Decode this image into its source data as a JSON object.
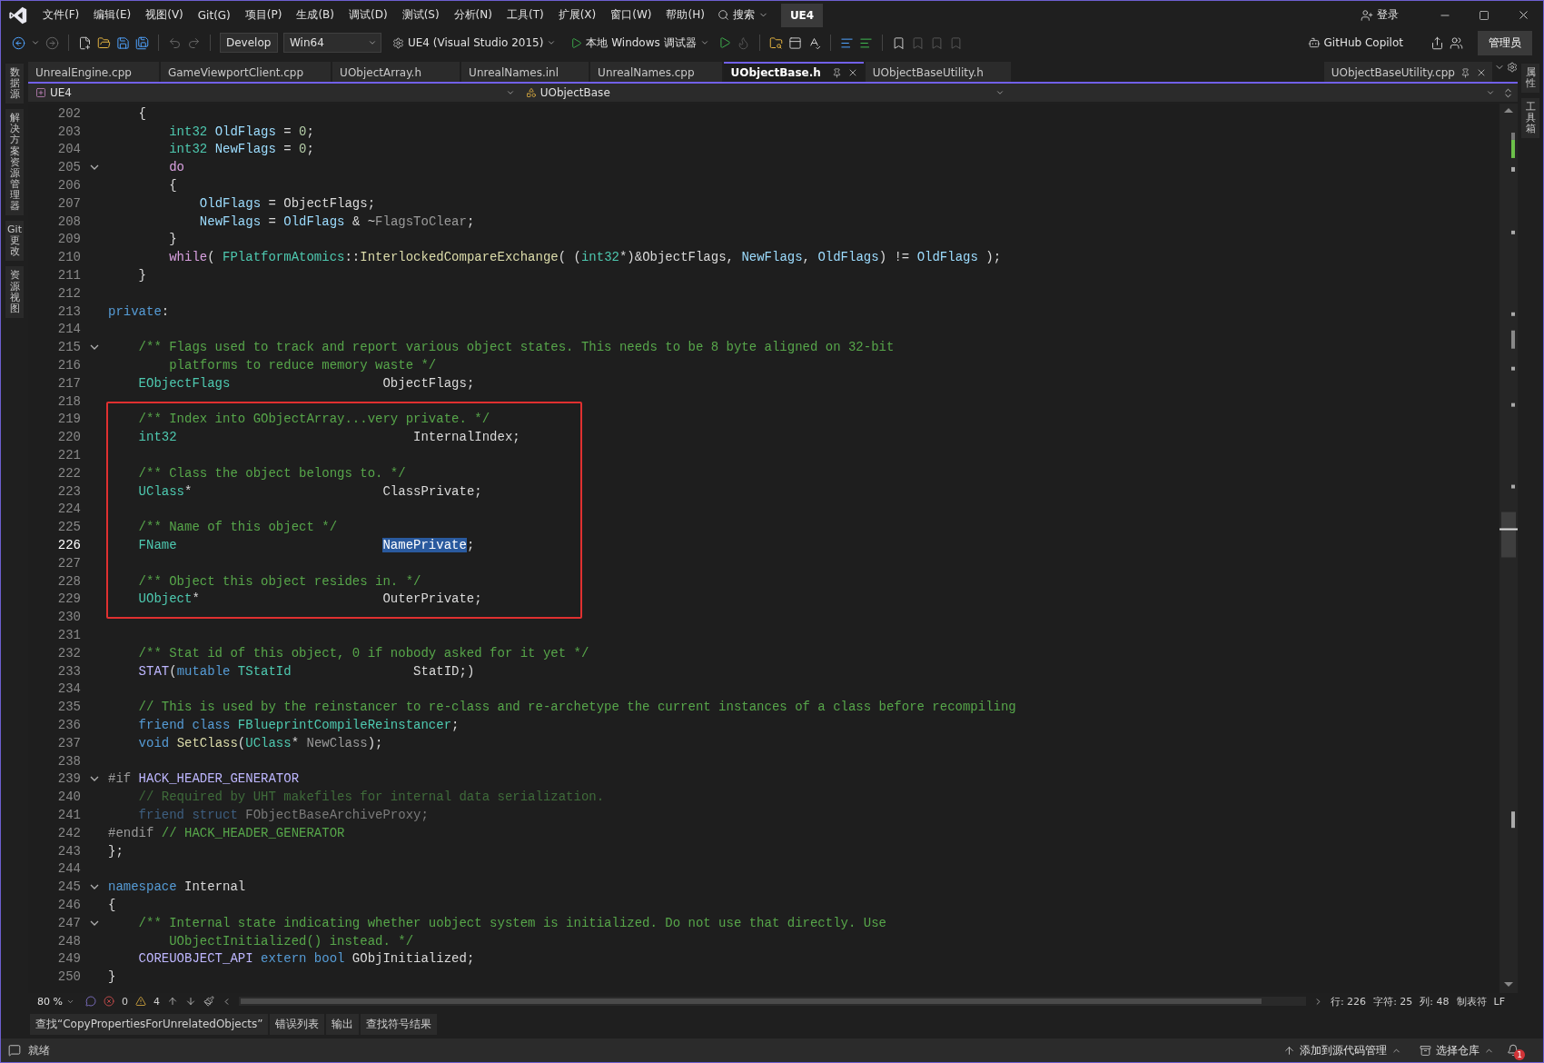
{
  "menu_bar": {
    "items": [
      "文件(F)",
      "编辑(E)",
      "视图(V)",
      "Git(G)",
      "项目(P)",
      "生成(B)",
      "调试(D)",
      "测试(S)",
      "分析(N)",
      "工具(T)",
      "扩展(X)",
      "窗口(W)",
      "帮助(H)"
    ],
    "search": "搜索",
    "solution": "UE4",
    "sign_in": "登录"
  },
  "toolbar": {
    "configuration": "Develop",
    "platform": "Win64",
    "startup_project": "UE4 (Visual Studio 2015)",
    "debugger": "本地 Windows 调试器",
    "copilot": "GitHub Copilot",
    "admin": "管理员"
  },
  "left_panels": [
    "数据源",
    "解决方案资源管理器",
    "Git 更改",
    "资源视图"
  ],
  "right_panels": [
    "属性",
    "工具箱"
  ],
  "tabs": [
    {
      "label": "UnrealEngine.cpp",
      "selected": false
    },
    {
      "label": "GameViewportClient.cpp",
      "selected": false
    },
    {
      "label": "UObjectArray.h",
      "selected": false
    },
    {
      "label": "UnrealNames.inl",
      "selected": false
    },
    {
      "label": "UnrealNames.cpp",
      "selected": false
    },
    {
      "label": "UObjectBase.h",
      "selected": true
    },
    {
      "label": "UObjectBaseUtility.h",
      "selected": false
    }
  ],
  "pinned_tab": {
    "label": "UObjectBaseUtility.cpp"
  },
  "navigation": {
    "project": "UE4",
    "scope": "UObjectBase"
  },
  "editor": {
    "sections": [
      {
        "framed": false,
        "lines": [
          {
            "number": "202",
            "fold": false,
            "current": false,
            "tokens": [
              {
                "kind": "plain",
                "text": "    {"
              }
            ]
          },
          {
            "number": "203",
            "fold": false,
            "current": false,
            "tokens": [
              {
                "kind": "type",
                "text": "        int32"
              },
              {
                "kind": "var",
                "text": " OldFlags"
              },
              {
                "kind": "plain",
                "text": " = "
              },
              {
                "kind": "num",
                "text": "0"
              },
              {
                "kind": "plain",
                "text": ";"
              }
            ]
          },
          {
            "number": "204",
            "fold": false,
            "current": false,
            "tokens": [
              {
                "kind": "type",
                "text": "        int32"
              },
              {
                "kind": "var",
                "text": " NewFlags"
              },
              {
                "kind": "plain",
                "text": " = "
              },
              {
                "kind": "num",
                "text": "0"
              },
              {
                "kind": "plain",
                "text": ";"
              }
            ]
          },
          {
            "number": "205",
            "fold": true,
            "current": false,
            "tokens": [
              {
                "kind": "ctrl",
                "text": "        do"
              }
            ]
          },
          {
            "number": "206",
            "fold": false,
            "current": false,
            "tokens": [
              {
                "kind": "plain",
                "text": "        {"
              }
            ]
          },
          {
            "number": "207",
            "fold": false,
            "current": false,
            "tokens": [
              {
                "kind": "var",
                "text": "            OldFlags"
              },
              {
                "kind": "plain",
                "text": " = ObjectFlags;"
              }
            ]
          },
          {
            "number": "208",
            "fold": false,
            "current": false,
            "tokens": [
              {
                "kind": "var",
                "text": "            NewFlags"
              },
              {
                "kind": "plain",
                "text": " = "
              },
              {
                "kind": "var",
                "text": "OldFlags"
              },
              {
                "kind": "plain",
                "text": " & ~"
              },
              {
                "kind": "param",
                "text": "FlagsToClear"
              },
              {
                "kind": "plain",
                "text": ";"
              }
            ]
          },
          {
            "number": "209",
            "fold": false,
            "current": false,
            "tokens": [
              {
                "kind": "plain",
                "text": "        }"
              }
            ]
          },
          {
            "number": "210",
            "fold": false,
            "current": false,
            "tokens": [
              {
                "kind": "ctrl",
                "text": "        while"
              },
              {
                "kind": "plain",
                "text": "( "
              },
              {
                "kind": "type",
                "text": "FPlatformAtomics"
              },
              {
                "kind": "plain",
                "text": "::"
              },
              {
                "kind": "func",
                "text": "InterlockedCompareExchange"
              },
              {
                "kind": "plain",
                "text": "( ("
              },
              {
                "kind": "type",
                "text": "int32"
              },
              {
                "kind": "plain",
                "text": "*)&ObjectFlags, "
              },
              {
                "kind": "var",
                "text": "NewFlags"
              },
              {
                "kind": "plain",
                "text": ", "
              },
              {
                "kind": "var",
                "text": "OldFlags"
              },
              {
                "kind": "plain",
                "text": ") != "
              },
              {
                "kind": "var",
                "text": "OldFlags"
              },
              {
                "kind": "plain",
                "text": " );"
              }
            ]
          },
          {
            "number": "211",
            "fold": false,
            "current": false,
            "tokens": [
              {
                "kind": "plain",
                "text": "    }"
              }
            ]
          },
          {
            "number": "212",
            "fold": false,
            "current": false
          },
          {
            "number": "213",
            "fold": false,
            "current": false,
            "tokens": [
              {
                "kind": "kw",
                "text": "private"
              },
              {
                "kind": "plain",
                "text": ":"
              }
            ]
          },
          {
            "number": "214",
            "fold": false,
            "current": false
          },
          {
            "number": "215",
            "fold": true,
            "current": false,
            "tokens": [
              {
                "kind": "comment",
                "text": "    /** Flags used to track and report various object states. This needs to be 8 byte aligned on 32-bit"
              }
            ]
          },
          {
            "number": "216",
            "fold": false,
            "current": false,
            "tokens": [
              {
                "kind": "comment",
                "text": "        platforms to reduce memory waste */"
              }
            ]
          },
          {
            "number": "217",
            "fold": false,
            "current": false,
            "tokens": [
              {
                "kind": "type",
                "text": "    EObjectFlags"
              },
              {
                "kind": "plain",
                "text": "                    ObjectFlags;"
              }
            ]
          },
          {
            "number": "218",
            "fold": false,
            "current": false
          }
        ]
      },
      {
        "framed": true,
        "lines": [
          {
            "number": "219",
            "fold": false,
            "current": false,
            "tokens": [
              {
                "kind": "comment",
                "text": "    /** Index into GObjectArray...very private. */"
              }
            ]
          },
          {
            "number": "220",
            "fold": false,
            "current": false,
            "tokens": [
              {
                "kind": "type",
                "text": "    int32"
              },
              {
                "kind": "plain",
                "text": "                               InternalIndex;"
              }
            ]
          },
          {
            "number": "221",
            "fold": false,
            "current": false
          },
          {
            "number": "222",
            "fold": false,
            "current": false,
            "tokens": [
              {
                "kind": "comment",
                "text": "    /** Class the object belongs to. */"
              }
            ]
          },
          {
            "number": "223",
            "fold": false,
            "current": false,
            "tokens": [
              {
                "kind": "type",
                "text": "    UClass"
              },
              {
                "kind": "plain",
                "text": "*                         ClassPrivate;"
              }
            ]
          },
          {
            "number": "224",
            "fold": false,
            "current": false
          },
          {
            "number": "225",
            "fold": false,
            "current": false,
            "tokens": [
              {
                "kind": "comment",
                "text": "    /** Name of this object */"
              }
            ]
          },
          {
            "number": "226",
            "fold": false,
            "current": true,
            "tokens": [
              {
                "kind": "type",
                "text": "    FName                           "
              },
              {
                "kind": "selected",
                "text": "NamePrivate"
              },
              {
                "kind": "plain",
                "text": ";"
              }
            ]
          },
          {
            "number": "227",
            "fold": false,
            "current": false
          },
          {
            "number": "228",
            "fold": false,
            "current": false,
            "tokens": [
              {
                "kind": "comment",
                "text": "    /** Object this object resides in. */"
              }
            ]
          },
          {
            "number": "229",
            "fold": false,
            "current": false,
            "tokens": [
              {
                "kind": "type",
                "text": "    UObject"
              },
              {
                "kind": "plain",
                "text": "*                        OuterPrivate;"
              }
            ]
          }
        ]
      },
      {
        "framed": false,
        "lines": [
          {
            "number": "230",
            "fold": false,
            "current": false
          },
          {
            "number": "231",
            "fold": false,
            "current": false
          },
          {
            "number": "232",
            "fold": false,
            "current": false,
            "tokens": [
              {
                "kind": "comment",
                "text": "    /** Stat id of this object, 0 if nobody asked for it yet */"
              }
            ]
          },
          {
            "number": "233",
            "fold": false,
            "current": false,
            "tokens": [
              {
                "kind": "macro",
                "text": "    STAT"
              },
              {
                "kind": "plain",
                "text": "("
              },
              {
                "kind": "kw",
                "text": "mutable "
              },
              {
                "kind": "type",
                "text": "TStatId"
              },
              {
                "kind": "plain",
                "text": "                StatID;)"
              }
            ]
          },
          {
            "number": "234",
            "fold": false,
            "current": false
          },
          {
            "number": "235",
            "fold": false,
            "current": false,
            "tokens": [
              {
                "kind": "comment",
                "text": "    // This is used by the reinstancer to re-class and re-archetype the current instances of a class before recompiling"
              }
            ]
          },
          {
            "number": "236",
            "fold": false,
            "current": false,
            "tokens": [
              {
                "kind": "kw",
                "text": "    friend class "
              },
              {
                "kind": "type",
                "text": "FBlueprintCompileReinstancer"
              },
              {
                "kind": "plain",
                "text": ";"
              }
            ]
          },
          {
            "number": "237",
            "fold": false,
            "current": false,
            "tokens": [
              {
                "kind": "kw",
                "text": "    void "
              },
              {
                "kind": "func",
                "text": "SetClass"
              },
              {
                "kind": "plain",
                "text": "("
              },
              {
                "kind": "type",
                "text": "UClass"
              },
              {
                "kind": "plain",
                "text": "* "
              },
              {
                "kind": "param",
                "text": "NewClass"
              },
              {
                "kind": "plain",
                "text": ");"
              }
            ]
          },
          {
            "number": "238",
            "fold": false,
            "current": false
          },
          {
            "number": "239",
            "fold": true,
            "current": false,
            "tokens": [
              {
                "kind": "preproc",
                "text": "#if "
              },
              {
                "kind": "macro",
                "text": "HACK_HEADER_GENERATOR"
              }
            ]
          },
          {
            "number": "240",
            "fold": false,
            "current": false,
            "tokens": [
              {
                "kind": "inactive-comment",
                "text": "    // Required by UHT makefiles for internal data serialization."
              }
            ]
          },
          {
            "number": "241",
            "fold": false,
            "current": false,
            "tokens": [
              {
                "kind": "inactive-kw",
                "text": "    friend struct"
              },
              {
                "kind": "inactive",
                "text": " FObjectBaseArchiveProxy;"
              }
            ]
          },
          {
            "number": "242",
            "fold": false,
            "current": false,
            "tokens": [
              {
                "kind": "preproc",
                "text": "#endif "
              },
              {
                "kind": "comment",
                "text": "// HACK_HEADER_GENERATOR"
              }
            ]
          },
          {
            "number": "243",
            "fold": false,
            "current": false,
            "tokens": [
              {
                "kind": "plain",
                "text": "};"
              }
            ]
          },
          {
            "number": "244",
            "fold": false,
            "current": false
          },
          {
            "number": "245",
            "fold": true,
            "current": false,
            "tokens": [
              {
                "kind": "kw",
                "text": "namespace"
              },
              {
                "kind": "plain",
                "text": " Internal"
              }
            ]
          },
          {
            "number": "246",
            "fold": false,
            "current": false,
            "tokens": [
              {
                "kind": "plain",
                "text": "{"
              }
            ]
          },
          {
            "number": "247",
            "fold": true,
            "current": false,
            "tokens": [
              {
                "kind": "comment",
                "text": "    /** Internal state indicating whether uobject system is initialized. Do not use that directly. Use"
              }
            ]
          },
          {
            "number": "248",
            "fold": false,
            "current": false,
            "tokens": [
              {
                "kind": "comment",
                "text": "        UObjectInitialized() instead. */"
              }
            ]
          },
          {
            "number": "249",
            "fold": false,
            "current": false,
            "tokens": [
              {
                "kind": "macro",
                "text": "    COREUOBJECT_API "
              },
              {
                "kind": "kw",
                "text": "extern bool"
              },
              {
                "kind": "plain",
                "text": " GObjInitialized;"
              }
            ]
          },
          {
            "number": "250",
            "fold": false,
            "current": false,
            "tokens": [
              {
                "kind": "plain",
                "text": "}"
              }
            ]
          }
        ]
      }
    ]
  },
  "editor_status": {
    "zoom": "80 %",
    "errors": "0",
    "warnings": "4",
    "line": "行: 226",
    "character": "字符: 25",
    "column": "列: 48",
    "indentation": "制表符",
    "line_ending": "LF"
  },
  "tool_tabs": [
    "查找“CopyPropertiesForUnrelatedObjects”",
    "错误列表",
    "输出",
    "查找符号结果"
  ],
  "status_bar": {
    "message": "就绪",
    "source_control": "添加到源代码管理",
    "repository": "选择仓库",
    "notifications": "1"
  }
}
